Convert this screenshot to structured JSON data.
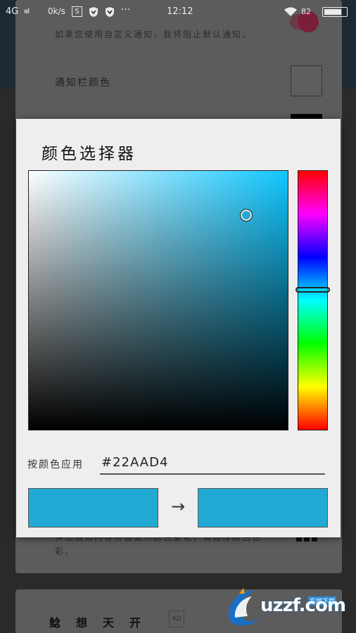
{
  "status_bar": {
    "carrier": "4G",
    "signal": "ıııl",
    "speed": "0k/s",
    "icon_box": "S",
    "more": "···",
    "time": "12:12",
    "battery_pct": "82",
    "battery_level": 0.82
  },
  "background": {
    "hint_text": "如果您使用自定义通知，我将阻止默认通知。",
    "row_label": "通知栏颜色",
    "hint_text_2": "弹出通知内容将被显示颜色变化，请选择颜色色彩。",
    "bottom_row": "鲶想天开",
    "ad_label": "AD"
  },
  "dialog": {
    "title": "颜色选择器",
    "hex_label": "按颜色应用",
    "hex_value": "#22AAD4",
    "arrow": "→",
    "hue_color": "#10c6ff",
    "hue_position": 0.46,
    "saturation": 0.84,
    "brightness": 0.83,
    "old_color": "#22aad4",
    "new_color": "#22aad4"
  },
  "watermark": {
    "brand": "uzzf.com",
    "sub": "东坡下载"
  }
}
